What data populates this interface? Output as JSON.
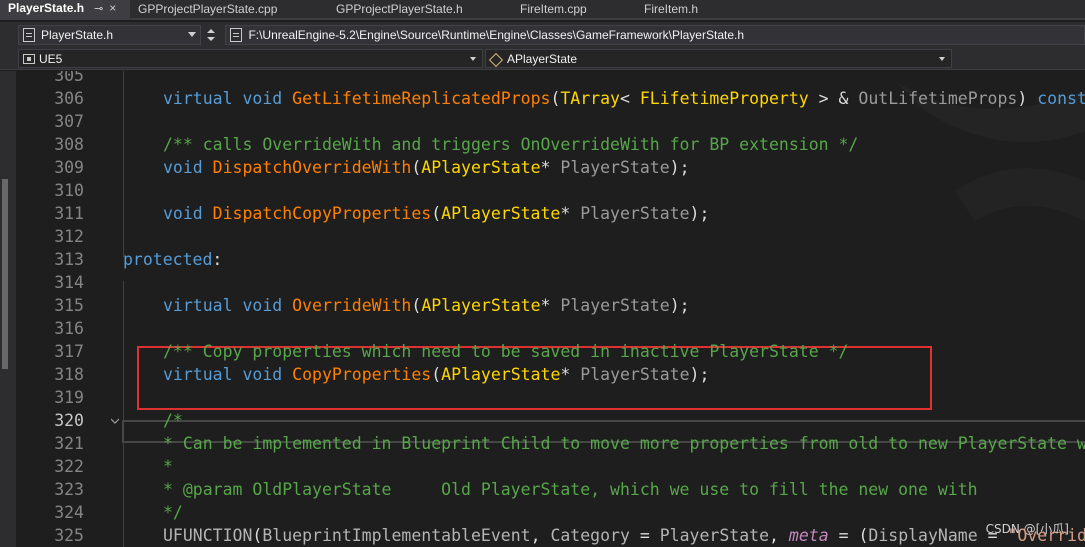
{
  "tabs": [
    {
      "label": "PlayerState.h",
      "active": true
    },
    {
      "label": "GPProjectPlayerState.cpp",
      "active": false
    },
    {
      "label": "GPProjectPlayerState.h",
      "active": false
    },
    {
      "label": "FireItem.cpp",
      "active": false
    },
    {
      "label": "FireItem.h",
      "active": false
    }
  ],
  "tab_icons": {
    "pin": "⊸",
    "close": "×"
  },
  "filebar": {
    "file_combo": "PlayerState.h",
    "path": "F:\\UnrealEngine-5.2\\Engine\\Source\\Runtime\\Engine\\Classes\\GameFramework\\PlayerState.h"
  },
  "scopebar": {
    "project": "UE5",
    "scope": "APlayerState"
  },
  "editor": {
    "current_line": "320",
    "lines": [
      {
        "n": "305",
        "segs": []
      },
      {
        "n": "306",
        "segs": [
          [
            "kw",
            "virtual "
          ],
          [
            "kw",
            "void "
          ],
          [
            "fn",
            "GetLifetimeReplicatedProps"
          ],
          [
            "tx",
            "("
          ],
          [
            "ty",
            "TArray"
          ],
          [
            "tx",
            "< "
          ],
          [
            "ty",
            "FLifetimeProperty"
          ],
          [
            "tx",
            " > & "
          ],
          [
            "pm",
            "OutLifetimeProps"
          ],
          [
            "tx",
            ") "
          ],
          [
            "kw",
            "const"
          ]
        ]
      },
      {
        "n": "307",
        "segs": []
      },
      {
        "n": "308",
        "segs": [
          [
            "cm",
            "/** calls OverrideWith and triggers OnOverrideWith for BP extension */"
          ]
        ]
      },
      {
        "n": "309",
        "segs": [
          [
            "kw",
            "void "
          ],
          [
            "fn",
            "DispatchOverrideWith"
          ],
          [
            "tx",
            "("
          ],
          [
            "ty",
            "APlayerState"
          ],
          [
            "tx",
            "* "
          ],
          [
            "pm",
            "PlayerState"
          ],
          [
            "tx",
            ");"
          ]
        ]
      },
      {
        "n": "310",
        "segs": []
      },
      {
        "n": "311",
        "segs": [
          [
            "kw",
            "void "
          ],
          [
            "fn",
            "DispatchCopyProperties"
          ],
          [
            "tx",
            "("
          ],
          [
            "ty",
            "APlayerState"
          ],
          [
            "tx",
            "* "
          ],
          [
            "pm",
            "PlayerState"
          ],
          [
            "tx",
            ");"
          ]
        ]
      },
      {
        "n": "312",
        "segs": []
      },
      {
        "n": "313",
        "segs": [
          [
            "kw",
            "protected"
          ],
          [
            "tx",
            ":"
          ]
        ]
      },
      {
        "n": "314",
        "segs": []
      },
      {
        "n": "315",
        "segs": [
          [
            "kw",
            "virtual "
          ],
          [
            "kw",
            "void "
          ],
          [
            "fn",
            "OverrideWith"
          ],
          [
            "tx",
            "("
          ],
          [
            "ty",
            "APlayerState"
          ],
          [
            "tx",
            "* "
          ],
          [
            "pm",
            "PlayerState"
          ],
          [
            "tx",
            ");"
          ]
        ]
      },
      {
        "n": "316",
        "segs": []
      },
      {
        "n": "317",
        "segs": [
          [
            "cm",
            "/** Copy properties which need to be saved in inactive PlayerState */"
          ]
        ]
      },
      {
        "n": "318",
        "segs": [
          [
            "kw",
            "virtual "
          ],
          [
            "kw",
            "void "
          ],
          [
            "fn",
            "CopyProperties"
          ],
          [
            "tx",
            "("
          ],
          [
            "ty",
            "APlayerState"
          ],
          [
            "tx",
            "* "
          ],
          [
            "pm",
            "PlayerState"
          ],
          [
            "tx",
            ");"
          ]
        ]
      },
      {
        "n": "319",
        "segs": []
      },
      {
        "n": "320",
        "segs": [
          [
            "cm",
            "/*"
          ]
        ]
      },
      {
        "n": "321",
        "segs": [
          [
            "cm",
            "* Can be implemented in Blueprint Child to move more properties from old to new PlayerState when traveling to a new level"
          ]
        ]
      },
      {
        "n": "322",
        "segs": [
          [
            "cm",
            "*"
          ]
        ]
      },
      {
        "n": "323",
        "segs": [
          [
            "cm",
            "* @param OldPlayerState     Old PlayerState, which we use to fill the new one with"
          ]
        ]
      },
      {
        "n": "324",
        "segs": [
          [
            "cm",
            "*/"
          ]
        ]
      },
      {
        "n": "325",
        "segs": [
          [
            "mc",
            "UFUNCTION"
          ],
          [
            "tx",
            "("
          ],
          [
            "mc",
            "BlueprintImplementableEvent"
          ],
          [
            "tx",
            ", "
          ],
          [
            "mc",
            "Category"
          ],
          [
            "tx",
            " = "
          ],
          [
            "mc",
            "PlayerState"
          ],
          [
            "tx",
            ", "
          ],
          [
            "it",
            "meta"
          ],
          [
            "tx",
            " = ("
          ],
          [
            "mc",
            "DisplayName"
          ],
          [
            "tx",
            " = "
          ],
          [
            "st",
            "\"OverrideWith\""
          ],
          [
            "tx",
            "))"
          ]
        ]
      }
    ]
  },
  "watermark_text": "CSDN @[小瓜]",
  "colors": {
    "highlight_box": "#e03131",
    "editor_bg": "#1e1e1e",
    "keyword": "#569cd6",
    "function": "#ff8000",
    "type": "#ffd700",
    "comment": "#57a64a"
  }
}
